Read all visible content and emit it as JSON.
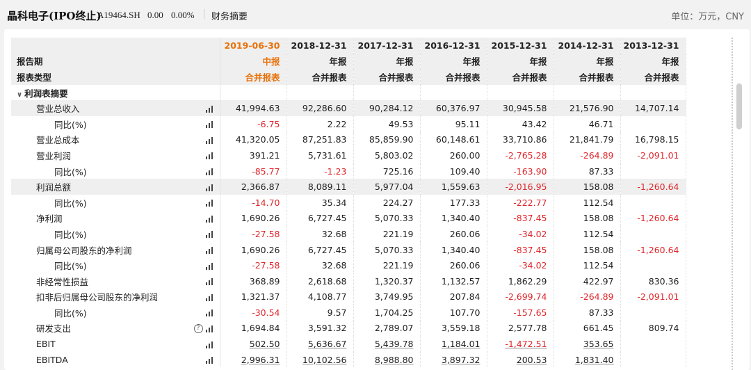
{
  "header": {
    "company": "晶科电子(IPO终止)",
    "code": "A19464.SH",
    "price": "0.00",
    "change": "0.00%",
    "tab": "财务摘要",
    "unit": "单位：万元，CNY"
  },
  "table": {
    "periods": [
      "2019-06-30",
      "2018-12-31",
      "2017-12-31",
      "2016-12-31",
      "2015-12-31",
      "2014-12-31",
      "2013-12-31"
    ],
    "report_period_label": "报告期",
    "report_period": [
      "中报",
      "年报",
      "年报",
      "年报",
      "年报",
      "年报",
      "年报"
    ],
    "report_type_label": "报表类型",
    "report_type": [
      "合并报表",
      "合并报表",
      "合并报表",
      "合并报表",
      "合并报表",
      "合并报表",
      "合并报表"
    ],
    "section": "利润表摘要",
    "rows": [
      {
        "label": "营业总收入",
        "values": [
          "41,994.63",
          "92,286.60",
          "90,284.12",
          "60,376.97",
          "30,945.58",
          "21,576.90",
          "14,707.14"
        ]
      },
      {
        "label": "同比(%)",
        "values": [
          "-6.75",
          "2.22",
          "49.53",
          "95.11",
          "43.42",
          "46.71",
          ""
        ]
      },
      {
        "label": "营业总成本",
        "values": [
          "41,320.05",
          "87,251.83",
          "85,859.90",
          "60,148.61",
          "33,710.86",
          "21,841.79",
          "16,798.15"
        ]
      },
      {
        "label": "营业利润",
        "values": [
          "391.21",
          "5,731.61",
          "5,803.02",
          "260.00",
          "-2,765.28",
          "-264.89",
          "-2,091.01"
        ]
      },
      {
        "label": "同比(%)",
        "values": [
          "-85.77",
          "-1.23",
          "725.16",
          "109.40",
          "-163.90",
          "87.33",
          ""
        ]
      },
      {
        "label": "利润总额",
        "values": [
          "2,366.87",
          "8,089.11",
          "5,977.04",
          "1,559.63",
          "-2,016.95",
          "158.08",
          "-1,260.64"
        ]
      },
      {
        "label": "同比(%)",
        "values": [
          "-14.70",
          "35.34",
          "224.27",
          "177.33",
          "-222.77",
          "112.54",
          ""
        ]
      },
      {
        "label": "净利润",
        "values": [
          "1,690.26",
          "6,727.45",
          "5,070.33",
          "1,340.40",
          "-837.45",
          "158.08",
          "-1,260.64"
        ]
      },
      {
        "label": "同比(%)",
        "values": [
          "-27.58",
          "32.68",
          "221.19",
          "260.06",
          "-34.02",
          "112.54",
          ""
        ]
      },
      {
        "label": "归属母公司股东的净利润",
        "values": [
          "1,690.26",
          "6,727.45",
          "5,070.33",
          "1,340.40",
          "-837.45",
          "158.08",
          "-1,260.64"
        ]
      },
      {
        "label": "同比(%)",
        "values": [
          "-27.58",
          "32.68",
          "221.19",
          "260.06",
          "-34.02",
          "112.54",
          ""
        ]
      },
      {
        "label": "非经常性损益",
        "values": [
          "368.89",
          "2,618.68",
          "1,320.37",
          "1,132.57",
          "1,862.29",
          "422.97",
          "830.36"
        ]
      },
      {
        "label": "扣非后归属母公司股东的净利润",
        "values": [
          "1,321.37",
          "4,108.77",
          "3,749.95",
          "207.84",
          "-2,699.74",
          "-264.89",
          "-2,091.01"
        ]
      },
      {
        "label": "同比(%)",
        "values": [
          "-30.54",
          "9.57",
          "1,704.25",
          "107.70",
          "-157.65",
          "87.33",
          ""
        ]
      },
      {
        "label": "研发支出",
        "values": [
          "1,694.84",
          "3,591.32",
          "2,789.07",
          "3,559.18",
          "2,577.78",
          "661.45",
          "809.74"
        ]
      },
      {
        "label": "EBIT",
        "values": [
          "502.50",
          "5,636.67",
          "5,439.78",
          "1,184.01",
          "-1,472.51",
          "353.65",
          ""
        ]
      },
      {
        "label": "EBITDA",
        "values": [
          "2,996.31",
          "10,102.56",
          "8,988.80",
          "3,897.32",
          "200.53",
          "1,831.40",
          ""
        ]
      }
    ]
  },
  "colors": {
    "highlight": "#e8710a",
    "negative": "#e0262b"
  },
  "icons": {
    "chart": "bar-chart-icon",
    "help": "help-icon",
    "collapse": "chevron-down-icon"
  }
}
